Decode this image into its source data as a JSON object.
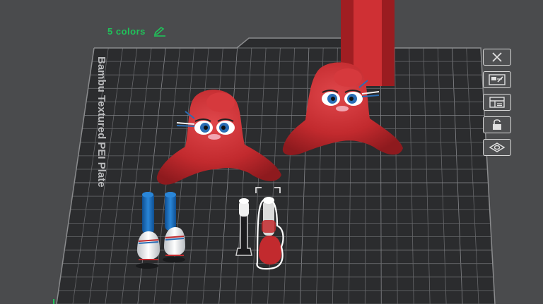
{
  "filament": {
    "colors_label": "5 colors"
  },
  "plate": {
    "name": "Bambu Textured PEI Plate"
  },
  "icons": {
    "edit": "pencil-icon",
    "toolbar": [
      "close-icon",
      "auto-arrange-icon",
      "plate-settings-icon",
      "lock-icon",
      "view-icon"
    ]
  },
  "colors": {
    "filament_label": "#1fc35a",
    "background": "#4a4b4d",
    "plate": "#2b2c2e",
    "grid": "#6d6e70",
    "model_red": "#c22a2e",
    "model_blue": "#1766b4",
    "selection": "#ffffff"
  }
}
